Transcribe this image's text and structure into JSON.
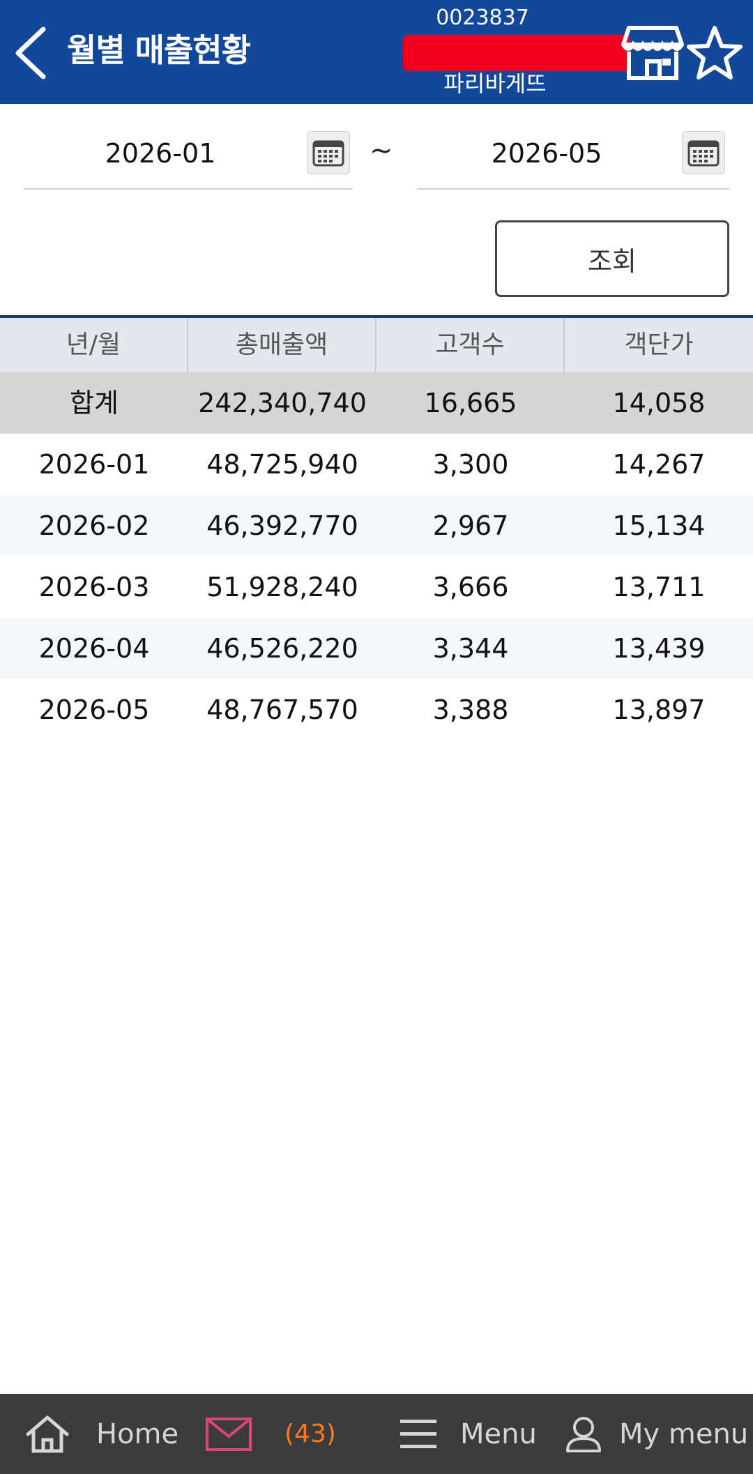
{
  "header": {
    "title": "월별 매출현황",
    "store_code": "0023837",
    "brand": "파리바게뜨"
  },
  "icons": {
    "back": "chevron-left-icon",
    "store": "store-icon",
    "favorite": "star-icon",
    "calendar": "calendar-icon",
    "home": "home-icon",
    "mail": "mail-icon",
    "menu": "hamburger-menu-icon",
    "user": "user-icon"
  },
  "colors": {
    "header_bg": "#12479a",
    "redaction": "#f3001f",
    "nav_bg": "#3b3b3d",
    "mail_icon": "#e0457a",
    "badge": "#ff7a1a"
  },
  "filters": {
    "date_from": "2026-01",
    "separator": "~",
    "date_to": "2026-05",
    "search_label": "조회"
  },
  "table": {
    "columns": [
      "년/월",
      "총매출액",
      "고객수",
      "객단가"
    ],
    "summary": [
      "합계",
      "242,340,740",
      "16,665",
      "14,058"
    ],
    "rows": [
      [
        "2026-01",
        "48,725,940",
        "3,300",
        "14,267"
      ],
      [
        "2026-02",
        "46,392,770",
        "2,967",
        "15,134"
      ],
      [
        "2026-03",
        "51,928,240",
        "3,666",
        "13,711"
      ],
      [
        "2026-04",
        "46,526,220",
        "3,344",
        "13,439"
      ],
      [
        "2026-05",
        "48,767,570",
        "3,388",
        "13,897"
      ]
    ]
  },
  "nav": {
    "home": "Home",
    "message_count": "(43)",
    "menu": "Menu",
    "my_menu": "My menu"
  }
}
